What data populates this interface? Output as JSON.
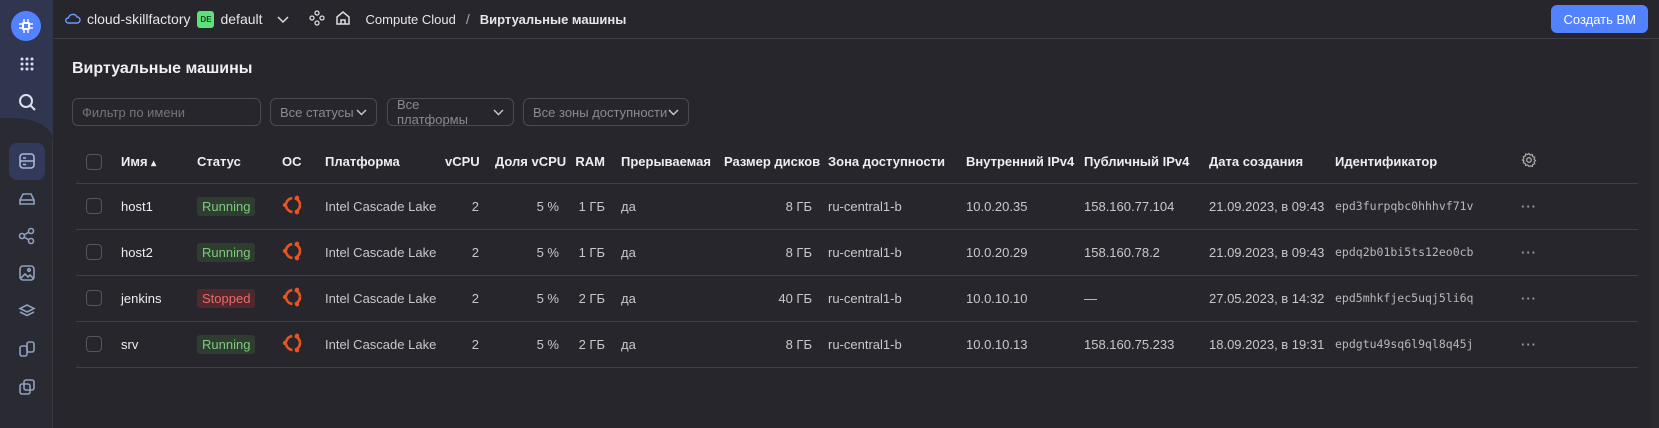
{
  "topbar": {
    "cloud": "cloud-skillfactory",
    "folder_badge": "DE",
    "folder": "default",
    "breadcrumb_service": "Compute Cloud",
    "breadcrumb_sep": "/",
    "breadcrumb_page": "Виртуальные машины",
    "create_button": "Создать ВМ"
  },
  "page": {
    "title": "Виртуальные машины"
  },
  "filters": {
    "name_placeholder": "Фильтр по имени",
    "status": "Все статусы",
    "platform": "Все платформы",
    "zone": "Все зоны доступности"
  },
  "table": {
    "headers": [
      "Имя",
      "Статус",
      "ОС",
      "Платформа",
      "vCPU",
      "Доля vCPU",
      "RAM",
      "Прерываемая",
      "Размер дисков",
      "Зона доступности",
      "Внутренний IPv4",
      "Публичный IPv4",
      "Дата создания",
      "Идентификатор"
    ],
    "sort_indicator": "▴",
    "rows": [
      {
        "name": "host1",
        "status": "Running",
        "os": "ubuntu",
        "platform": "Intel Cascade Lake",
        "vcpu": "2",
        "share": "5 %",
        "ram": "1 ГБ",
        "preemptible": "да",
        "disk": "8 ГБ",
        "zone": "ru-central1-b",
        "ip_int": "10.0.20.35",
        "ip_pub": "158.160.77.104",
        "created": "21.09.2023, в 09:43",
        "id": "epd3furpqbc0hhhvf71v",
        "more": "···"
      },
      {
        "name": "host2",
        "status": "Running",
        "os": "ubuntu",
        "platform": "Intel Cascade Lake",
        "vcpu": "2",
        "share": "5 %",
        "ram": "1 ГБ",
        "preemptible": "да",
        "disk": "8 ГБ",
        "zone": "ru-central1-b",
        "ip_int": "10.0.20.29",
        "ip_pub": "158.160.78.2",
        "created": "21.09.2023, в 09:43",
        "id": "epdq2b01bi5ts12eo0cb",
        "more": "···"
      },
      {
        "name": "jenkins",
        "status": "Stopped",
        "os": "ubuntu",
        "platform": "Intel Cascade Lake",
        "vcpu": "2",
        "share": "5 %",
        "ram": "2 ГБ",
        "preemptible": "да",
        "disk": "40 ГБ",
        "zone": "ru-central1-b",
        "ip_int": "10.0.10.10",
        "ip_pub": "—",
        "created": "27.05.2023, в 14:32",
        "id": "epd5mhkfjec5uqj5li6q",
        "more": "···"
      },
      {
        "name": "srv",
        "status": "Running",
        "os": "ubuntu",
        "platform": "Intel Cascade Lake",
        "vcpu": "2",
        "share": "5 %",
        "ram": "2 ГБ",
        "preemptible": "да",
        "disk": "8 ГБ",
        "zone": "ru-central1-b",
        "ip_int": "10.0.10.13",
        "ip_pub": "158.160.75.233",
        "created": "18.09.2023, в 19:31",
        "id": "epdgtu49sq6l9ql8q45j",
        "more": "···"
      }
    ]
  },
  "colors": {
    "accent": "#5282ff",
    "running": "#7ecb7e",
    "stopped": "#e9686e",
    "ubuntu": "#e95420"
  }
}
